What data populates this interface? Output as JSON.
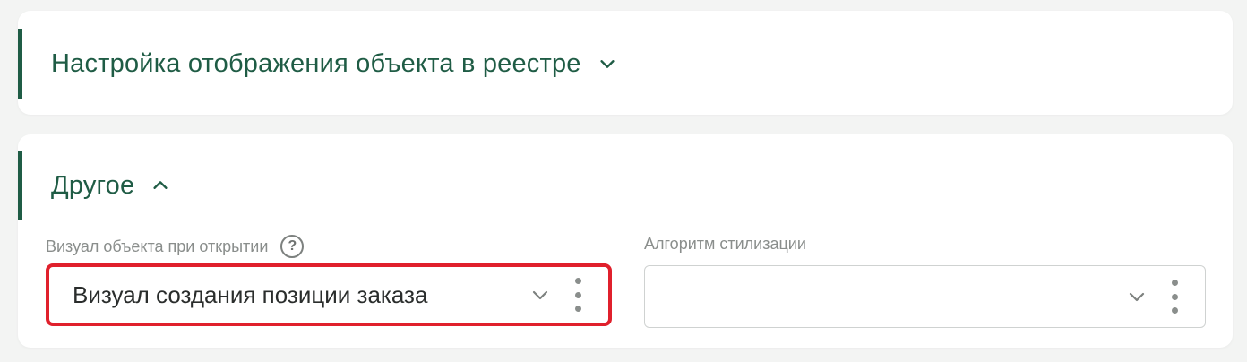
{
  "sections": {
    "display_settings": {
      "title": "Настройка отображения объекта в реестре",
      "expanded": false,
      "toggle_icon": "chevron-down-icon"
    },
    "other": {
      "title": "Другое",
      "expanded": true,
      "toggle_icon": "chevron-up-icon",
      "fields": {
        "visual_on_open": {
          "label": "Визуал объекта при открытии",
          "help_icon_text": "?",
          "value": "Визуал создания позиции заказа",
          "highlighted": true
        },
        "styling_algorithm": {
          "label": "Алгоритм стилизации",
          "value": ""
        }
      }
    }
  },
  "colors": {
    "accent": "#1f5c45",
    "highlight": "#e0202c",
    "label": "#8a8e8c",
    "background": "#f3f4f3"
  }
}
